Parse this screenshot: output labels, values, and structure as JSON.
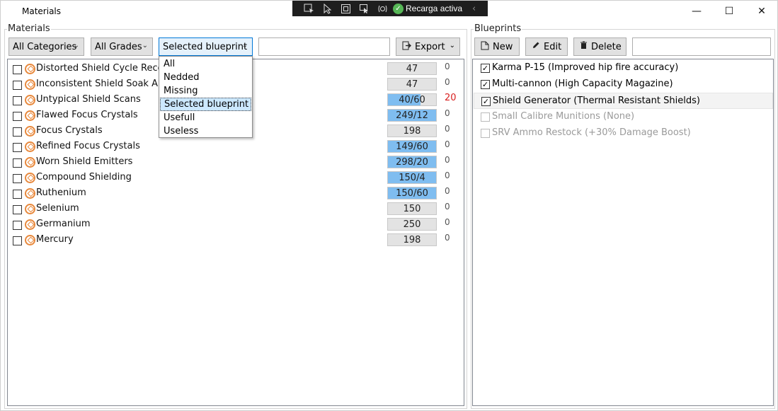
{
  "window": {
    "title": "Materials",
    "minimize_glyph": "—",
    "maximize_glyph": "☐",
    "close_glyph": "✕"
  },
  "devbar": {
    "hot_reload_label": "Recarga activa",
    "icons": [
      "select-element-icon",
      "pointer-icon",
      "frame-icon",
      "cursor-select-icon",
      "track-focus-icon"
    ]
  },
  "materials_panel": {
    "group_label": "Materials",
    "category_filter": {
      "value": "All Categories"
    },
    "grade_filter": {
      "value": "All Grades"
    },
    "blueprint_filter": {
      "value": "Selected blueprint",
      "options": [
        "All",
        "Nedded",
        "Missing",
        "Selected blueprint",
        "Usefull",
        "Useless"
      ],
      "selected_index": 3
    },
    "search": {
      "value": "",
      "placeholder": ""
    },
    "export_label": "Export",
    "rows": [
      {
        "name": "Distorted Shield Cycle Recordings",
        "qty": "47",
        "fill": 0,
        "need": "0"
      },
      {
        "name": "Inconsistent Shield Soak Analysis",
        "qty": "47",
        "fill": 0,
        "need": "0"
      },
      {
        "name": "Untypical Shield Scans",
        "qty": "40/60",
        "fill": 0.67,
        "need": "20",
        "need_red": true
      },
      {
        "name": "Flawed Focus Crystals",
        "qty": "249/12",
        "fill": 1,
        "need": "0"
      },
      {
        "name": "Focus Crystals",
        "qty": "198",
        "fill": 0,
        "need": "0"
      },
      {
        "name": "Refined Focus Crystals",
        "qty": "149/60",
        "fill": 1,
        "need": "0"
      },
      {
        "name": "Worn Shield Emitters",
        "qty": "298/20",
        "fill": 1,
        "need": "0"
      },
      {
        "name": "Compound Shielding",
        "qty": "150/4",
        "fill": 1,
        "need": "0"
      },
      {
        "name": "Ruthenium",
        "qty": "150/60",
        "fill": 1,
        "need": "0"
      },
      {
        "name": "Selenium",
        "qty": "150",
        "fill": 0,
        "need": "0"
      },
      {
        "name": "Germanium",
        "qty": "250",
        "fill": 0,
        "need": "0"
      },
      {
        "name": "Mercury",
        "qty": "198",
        "fill": 0,
        "need": "0"
      }
    ]
  },
  "blueprints_panel": {
    "group_label": "Blueprints",
    "new_label": "New",
    "edit_label": "Edit",
    "delete_label": "Delete",
    "search": {
      "value": "",
      "placeholder": ""
    },
    "rows": [
      {
        "name": "Karma P-15 (Improved hip fire accuracy)",
        "checked": true,
        "enabled": true
      },
      {
        "name": "Multi-cannon (High Capacity Magazine)",
        "checked": true,
        "enabled": true
      },
      {
        "name": "Shield Generator (Thermal Resistant Shields)",
        "checked": true,
        "enabled": true,
        "highlighted": true
      },
      {
        "name": "Small Calibre Munitions (None)",
        "checked": false,
        "enabled": false
      },
      {
        "name": "SRV Ammo Restock (+30% Damage Boost)",
        "checked": false,
        "enabled": false
      }
    ]
  },
  "colors": {
    "progress_fill": "#7fbdf0",
    "need_red": "#d81e1e",
    "material_icon": "#e8893d",
    "hot_reload_check": "#57b757"
  }
}
